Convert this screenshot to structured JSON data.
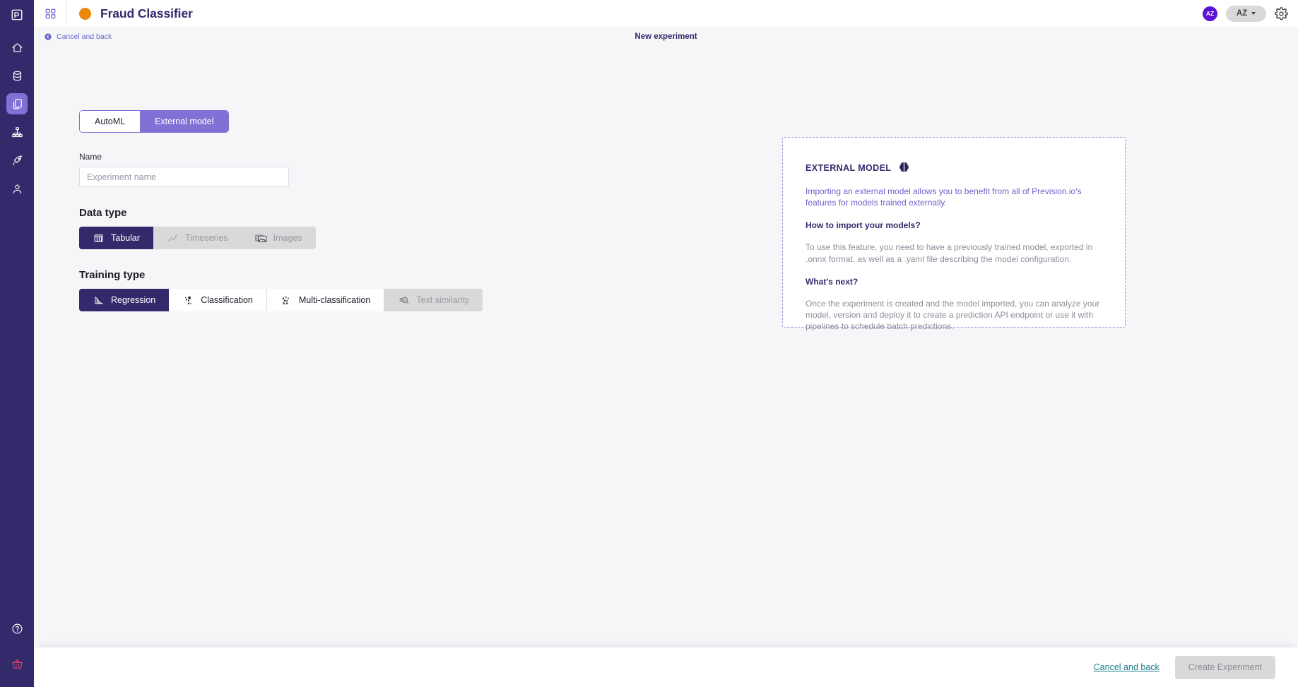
{
  "sidebar": {
    "logo_label": "prevision-logo",
    "items": [
      {
        "name": "home",
        "icon": "home-icon",
        "active": false
      },
      {
        "name": "data",
        "icon": "database-icon",
        "active": false
      },
      {
        "name": "experiments",
        "icon": "documents-icon",
        "active": true
      },
      {
        "name": "pipelines",
        "icon": "hierarchy-icon",
        "active": false
      },
      {
        "name": "deployments",
        "icon": "rocket-icon",
        "active": false
      },
      {
        "name": "account",
        "icon": "user-icon",
        "active": false
      }
    ],
    "bottom_items": [
      {
        "name": "help",
        "icon": "help-circle-icon"
      },
      {
        "name": "store",
        "icon": "basket-icon"
      }
    ]
  },
  "topbar": {
    "grid_icon": "grid-apps-icon",
    "project_title": "Fraud Classifier",
    "project_color": "#e8890c",
    "avatar_initials": "AZ",
    "user_menu_label": "AZ",
    "gear_icon": "gear-icon"
  },
  "subheader": {
    "cancel_label": "Cancel and back",
    "title": "New experiment"
  },
  "form": {
    "mode_toggle": {
      "options": [
        {
          "label": "AutoML",
          "selected": false
        },
        {
          "label": "External model",
          "selected": true
        }
      ]
    },
    "name_field": {
      "label": "Name",
      "value": "",
      "placeholder": "Experiment name"
    },
    "data_type": {
      "title": "Data type",
      "options": [
        {
          "label": "Tabular",
          "icon": "table-icon",
          "state": "selected"
        },
        {
          "label": "Timeseries",
          "icon": "timeseries-icon",
          "state": "disabled"
        },
        {
          "label": "Images",
          "icon": "images-icon",
          "state": "disabled"
        }
      ]
    },
    "training_type": {
      "title": "Training type",
      "options": [
        {
          "label": "Regression",
          "icon": "regression-icon",
          "state": "selected"
        },
        {
          "label": "Classification",
          "icon": "classification-icon",
          "state": "enabled"
        },
        {
          "label": "Multi-classification",
          "icon": "multi-classification-icon",
          "state": "enabled"
        },
        {
          "label": "Text similarity",
          "icon": "text-similarity-icon",
          "state": "disabled"
        }
      ]
    }
  },
  "info_panel": {
    "heading": "EXTERNAL MODEL",
    "heading_icon": "brain-icon",
    "intro": "Importing an external model allows you to benefit from all of Prevision.io's features for models trained externally.",
    "section1_title": "How to import your models?",
    "section1_body": "To use this feature, you need to have a previously trained model, exported in .onnx format, as well as a .yaml file describing the model configuration.",
    "section2_title": "What's next?",
    "section2_body": "Once the experiment is created and the model imported, you can analyze your model, version and deploy it to create a prediction API endpoint or use it with pipelines to schedule batch predictions."
  },
  "footer": {
    "cancel_label": "Cancel and back",
    "create_label": "Create Experiment",
    "create_enabled": false
  },
  "colors": {
    "rail": "#332a6b",
    "accent_purple": "#8071d6",
    "page_bg": "#f5f6f8",
    "teal_link": "#1b7f8f",
    "project_dot": "#e8890c",
    "basket_pink": "#f0456f"
  }
}
